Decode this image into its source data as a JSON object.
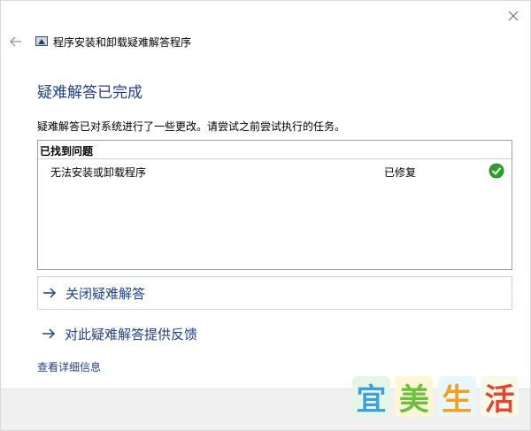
{
  "window": {
    "close_icon": "close-icon"
  },
  "titlebar": {
    "back_icon": "back-arrow-icon",
    "app_icon": "troubleshooter-icon",
    "title": "程序安装和卸载疑难解答程序"
  },
  "main": {
    "heading": "疑难解答已完成",
    "description": "疑难解答已对系统进行了一些更改。请尝试之前尝试执行的任务。",
    "results": {
      "header": "已找到问题",
      "problems": [
        {
          "name": "无法安装或卸载程序",
          "status": "已修复",
          "status_icon": "check-icon"
        }
      ]
    },
    "actions": [
      {
        "label": "关闭疑难解答",
        "icon": "arrow-right-icon"
      },
      {
        "label": "对此疑难解答提供反馈",
        "icon": "arrow-right-icon"
      }
    ],
    "detail_link": "查看详细信息"
  },
  "watermark": {
    "chars": [
      "宜",
      "美",
      "生",
      "活"
    ]
  },
  "colors": {
    "accent": "#1f3f8f",
    "success": "#2ca02c",
    "border": "#a0a0a0"
  }
}
